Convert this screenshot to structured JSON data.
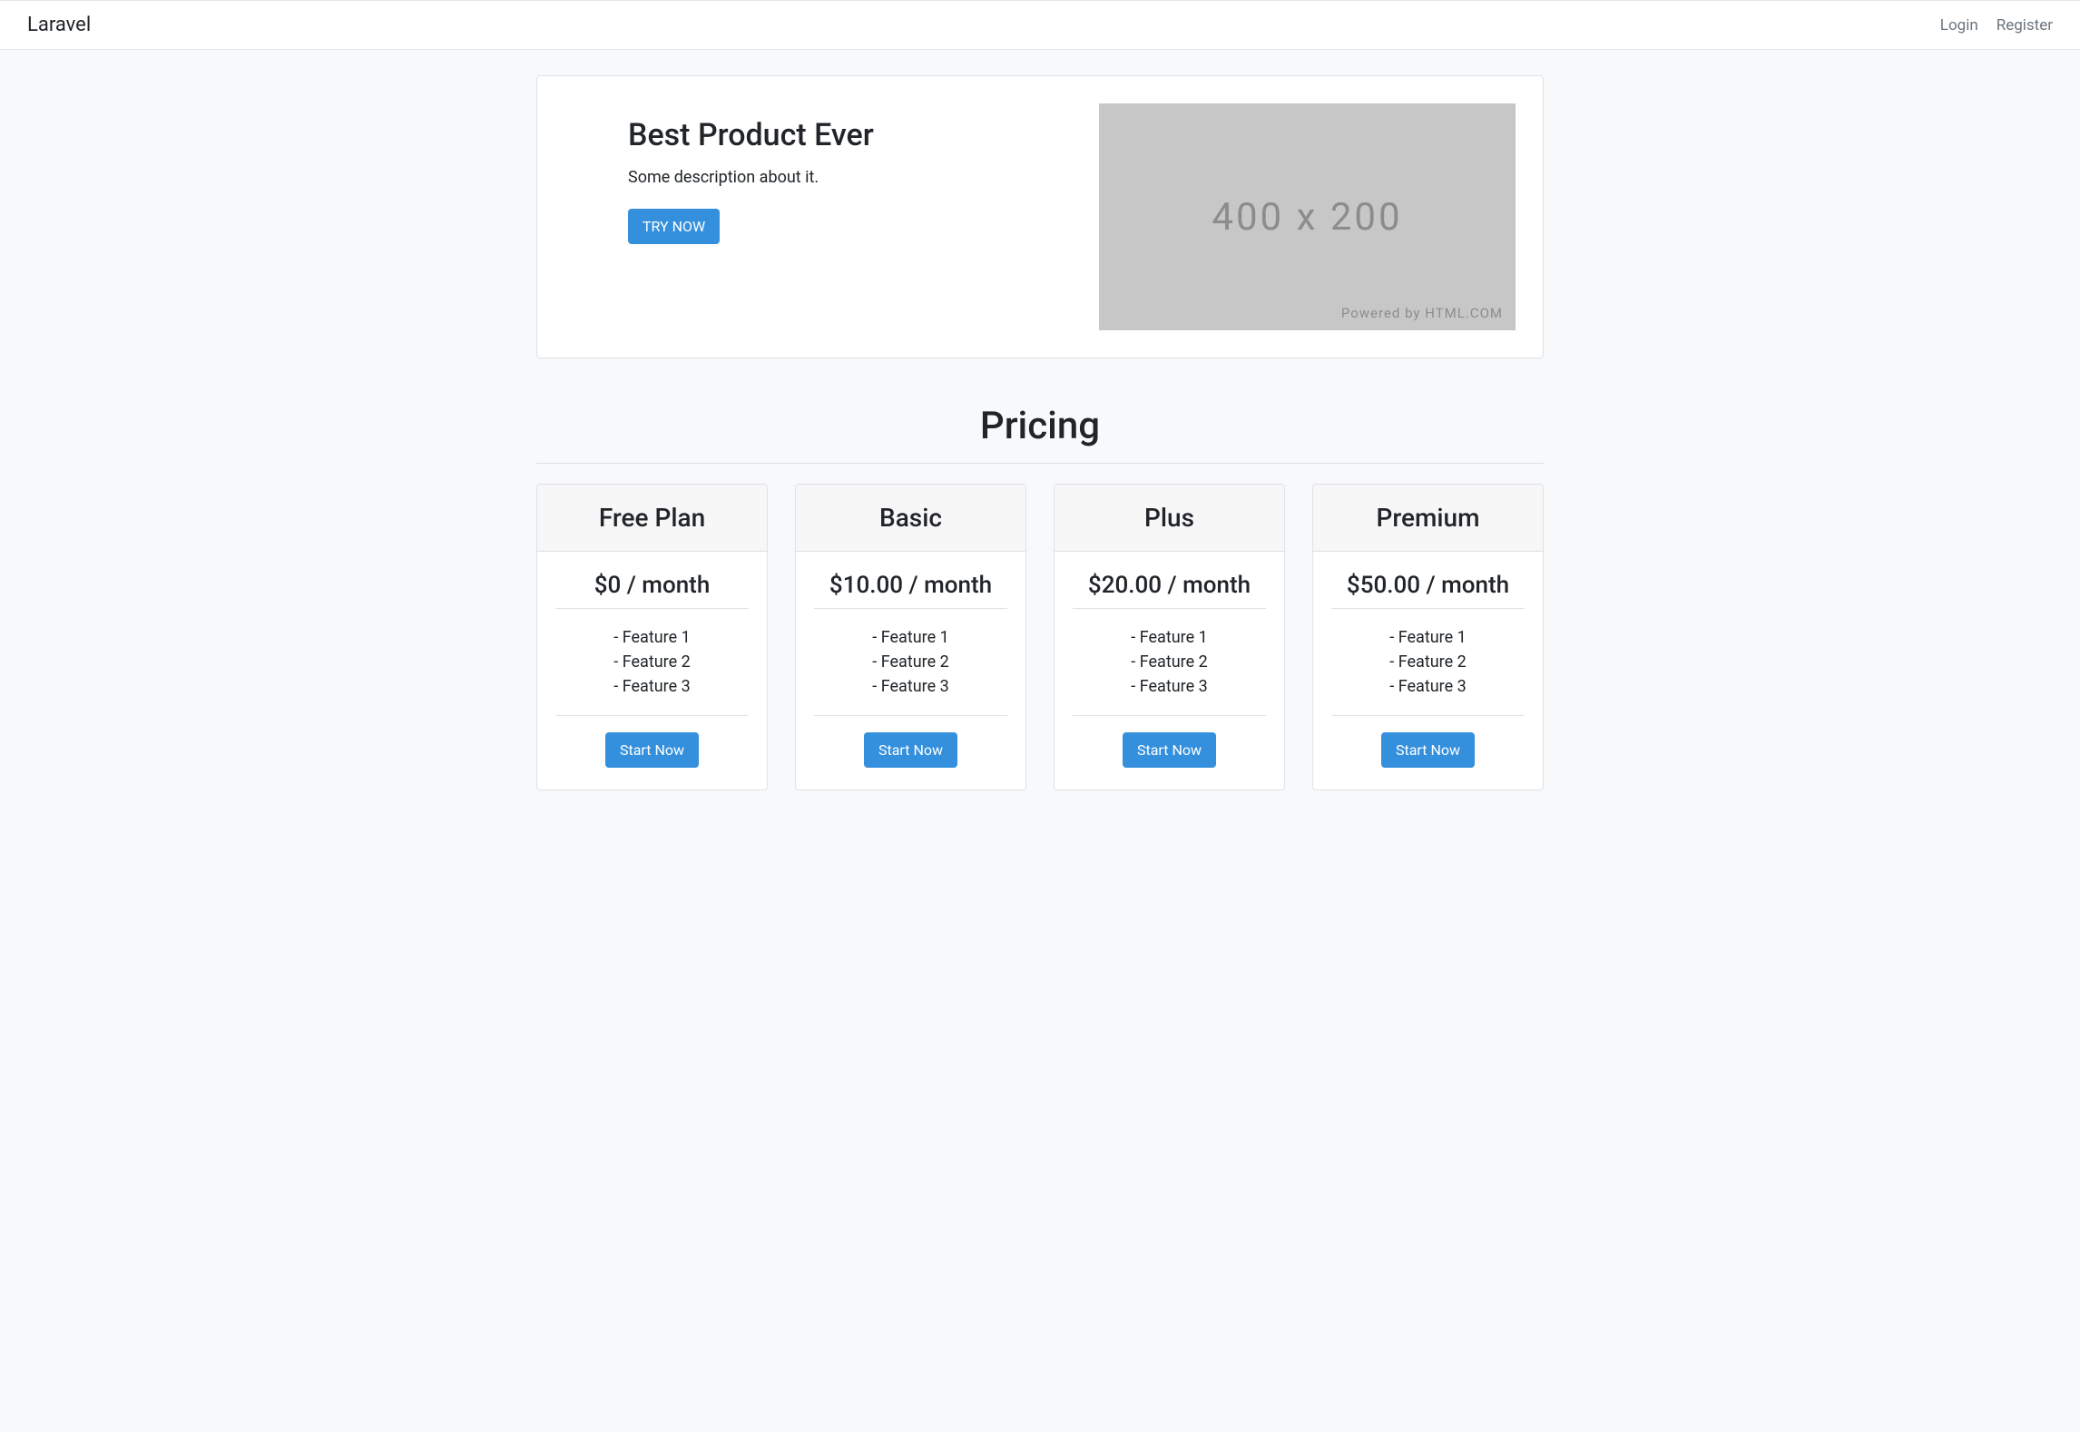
{
  "nav": {
    "brand": "Laravel",
    "login": "Login",
    "register": "Register"
  },
  "hero": {
    "title": "Best Product Ever",
    "description": "Some description about it.",
    "cta": "TRY NOW",
    "placeholder_label": "400 x 200",
    "placeholder_credit": "Powered by HTML.COM"
  },
  "pricing": {
    "title": "Pricing",
    "plans": [
      {
        "name": "Free Plan",
        "price": "$0 / month",
        "features": [
          "- Feature 1",
          "- Feature 2",
          "- Feature 3"
        ],
        "cta": "Start Now"
      },
      {
        "name": "Basic",
        "price": "$10.00 / month",
        "features": [
          "- Feature 1",
          "- Feature 2",
          "- Feature 3"
        ],
        "cta": "Start Now"
      },
      {
        "name": "Plus",
        "price": "$20.00 / month",
        "features": [
          "- Feature 1",
          "- Feature 2",
          "- Feature 3"
        ],
        "cta": "Start Now"
      },
      {
        "name": "Premium",
        "price": "$50.00 / month",
        "features": [
          "- Feature 1",
          "- Feature 2",
          "- Feature 3"
        ],
        "cta": "Start Now"
      }
    ]
  }
}
